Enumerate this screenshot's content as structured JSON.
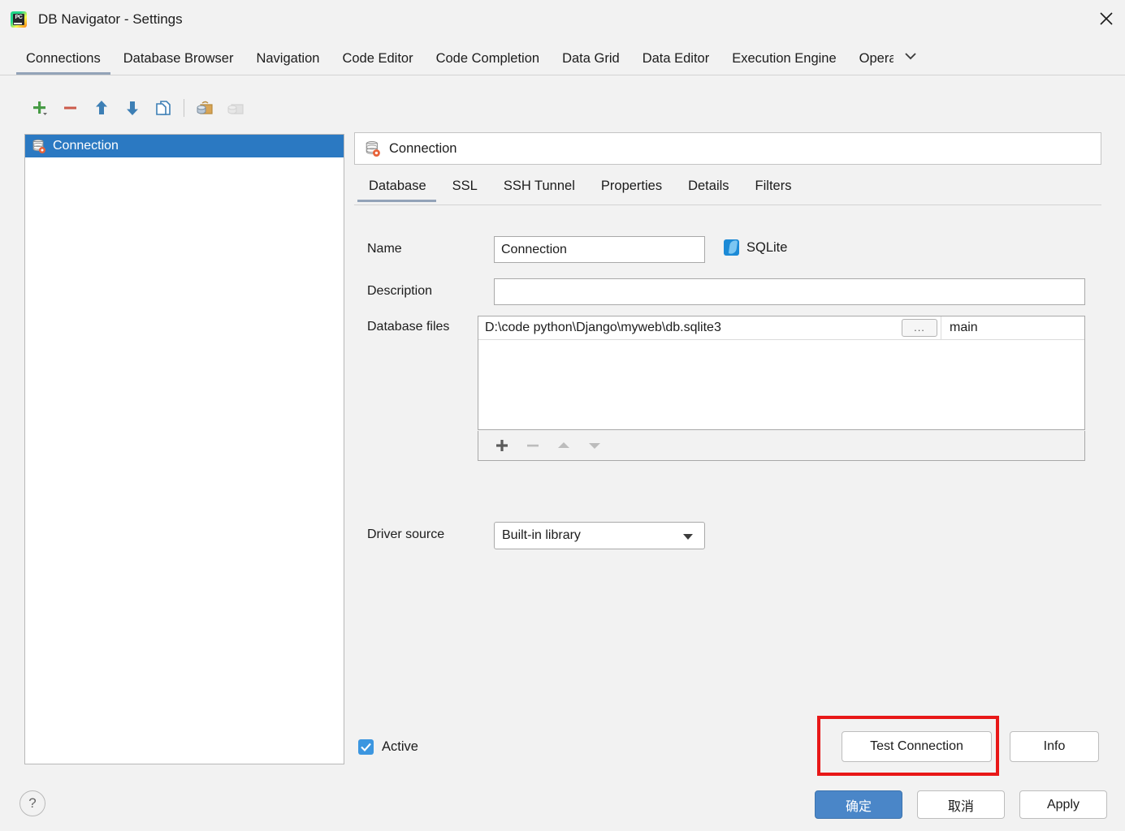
{
  "window": {
    "title": "DB Navigator - Settings",
    "app_icon": "pycharm-icon",
    "app_icon_text": "PC",
    "close_icon": "close-icon"
  },
  "tabs": [
    {
      "label": "Connections",
      "selected": true
    },
    {
      "label": "Database Browser",
      "selected": false
    },
    {
      "label": "Navigation",
      "selected": false
    },
    {
      "label": "Code Editor",
      "selected": false
    },
    {
      "label": "Code Completion",
      "selected": false
    },
    {
      "label": "Data Grid",
      "selected": false
    },
    {
      "label": "Data Editor",
      "selected": false
    },
    {
      "label": "Execution Engine",
      "selected": false
    },
    {
      "label": "Opera",
      "selected": false
    }
  ],
  "tab_overflow_icon": "chevron-down-icon",
  "toolbar": [
    {
      "name": "add-connection-button",
      "icon": "plus-icon",
      "enabled": true
    },
    {
      "name": "remove-connection-button",
      "icon": "minus-icon",
      "enabled": true
    },
    {
      "name": "move-up-button",
      "icon": "arrow-up-icon",
      "enabled": true
    },
    {
      "name": "move-down-button",
      "icon": "arrow-down-icon",
      "enabled": true
    },
    {
      "name": "duplicate-connection-button",
      "icon": "copy-icon",
      "enabled": true
    },
    {
      "name": "import-connection-button",
      "icon": "import-database-icon",
      "enabled": true
    },
    {
      "name": "export-connection-button",
      "icon": "export-database-icon",
      "enabled": false
    }
  ],
  "connection_list": [
    {
      "label": "Connection",
      "icon": "database-settings-icon",
      "selected": true
    }
  ],
  "detail": {
    "header_title": "Connection",
    "header_icon": "database-settings-icon",
    "subtabs": [
      {
        "label": "Database",
        "selected": true
      },
      {
        "label": "SSL",
        "selected": false
      },
      {
        "label": "SSH Tunnel",
        "selected": false
      },
      {
        "label": "Properties",
        "selected": false
      },
      {
        "label": "Details",
        "selected": false
      },
      {
        "label": "Filters",
        "selected": false
      }
    ],
    "fields": {
      "name_label": "Name",
      "name_value": "Connection",
      "database_type": "SQLite",
      "database_type_icon": "sqlite-feather-icon",
      "description_label": "Description",
      "description_value": "",
      "description_placeholder": "",
      "database_files_label": "Database files",
      "driver_source_label": "Driver source",
      "driver_source_value": "Built-in library"
    },
    "files_table": {
      "rows": [
        {
          "path": "D:\\code python\\Django\\myweb\\db.sqlite3",
          "browse_label": "...",
          "schema": "main"
        }
      ],
      "toolbar": [
        {
          "name": "add-file-button",
          "icon": "plus-icon",
          "enabled": true
        },
        {
          "name": "remove-file-button",
          "icon": "minus-icon",
          "enabled": false
        },
        {
          "name": "move-file-up-button",
          "icon": "triangle-up-icon",
          "enabled": false
        },
        {
          "name": "move-file-down-button",
          "icon": "triangle-down-icon",
          "enabled": false
        }
      ]
    },
    "active_checkbox": {
      "label": "Active",
      "checked": true
    },
    "test_connection_label": "Test Connection",
    "info_label": "Info"
  },
  "footer": {
    "help_label": "?",
    "ok_label": "确定",
    "cancel_label": "取消",
    "apply_label": "Apply"
  },
  "colors": {
    "accent_blue": "#2b79c2",
    "primary_button": "#4a86c8",
    "highlight_red": "#e81818",
    "tab_underline": "#93a3b8",
    "checkbox_blue": "#3c96e0"
  }
}
